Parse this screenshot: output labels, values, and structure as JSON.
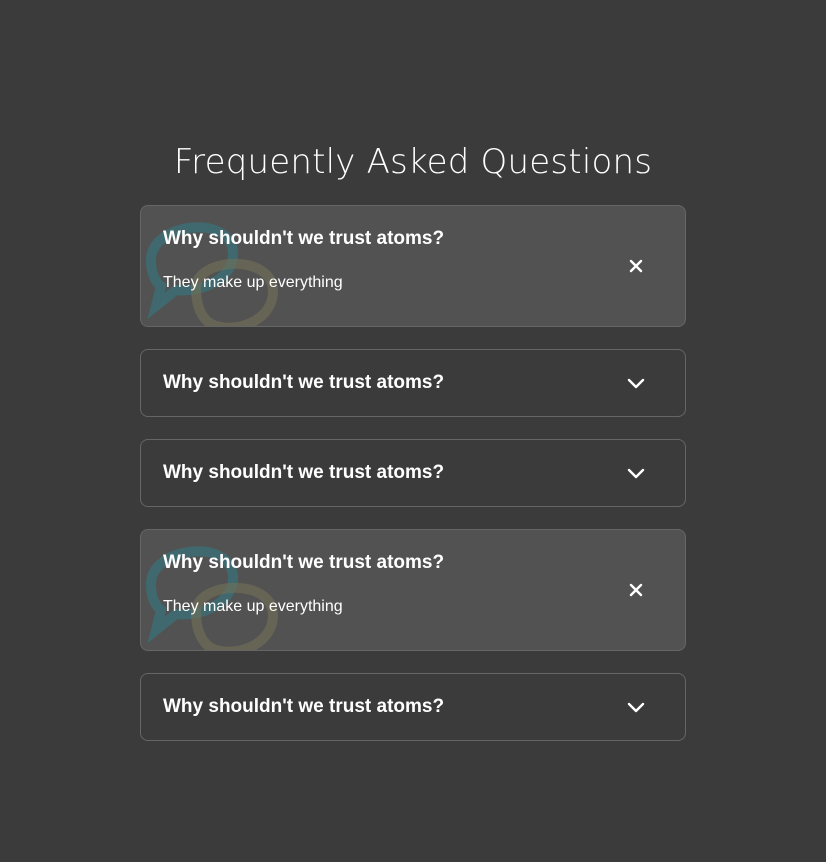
{
  "page": {
    "title": "Frequently Asked Questions"
  },
  "faq": {
    "items": [
      {
        "question": "Why shouldn't we trust atoms?",
        "answer": "They make up everything",
        "expanded": true,
        "toggle_icon": "close-icon"
      },
      {
        "question": "Why shouldn't we trust atoms?",
        "answer": "",
        "expanded": false,
        "toggle_icon": "chevron-down-icon"
      },
      {
        "question": "Why shouldn't we trust atoms?",
        "answer": "",
        "expanded": false,
        "toggle_icon": "chevron-down-icon"
      },
      {
        "question": "Why shouldn't we trust atoms?",
        "answer": "They make up everything",
        "expanded": true,
        "toggle_icon": "close-icon"
      },
      {
        "question": "Why shouldn't we trust atoms?",
        "answer": "",
        "expanded": false,
        "toggle_icon": "chevron-down-icon"
      }
    ]
  },
  "colors": {
    "background": "#3b3b3b",
    "open_card": "#525252",
    "border": "#666666",
    "text": "#ffffff",
    "bubble_teal": "#2f7c86",
    "bubble_olive": "#777356"
  }
}
